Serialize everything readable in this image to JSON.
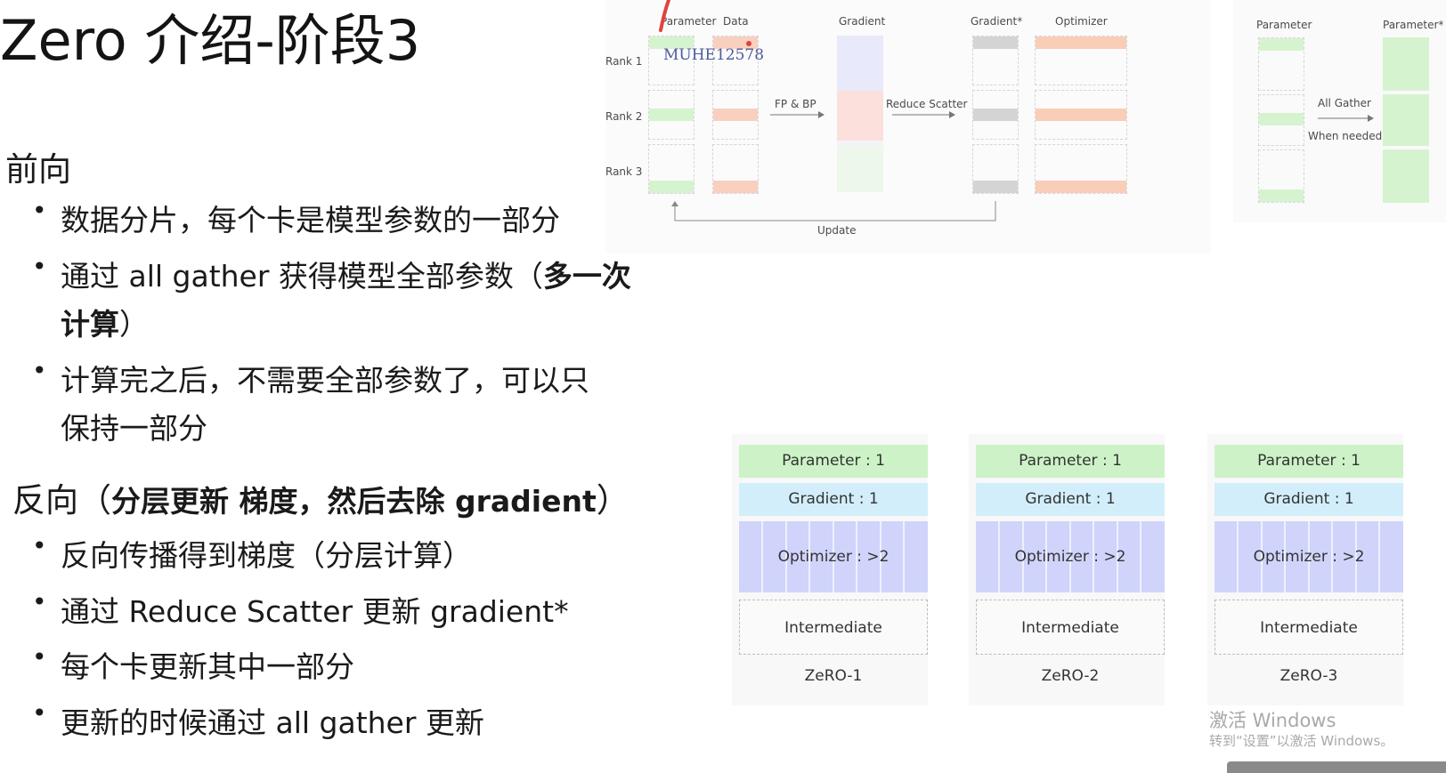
{
  "title": "Zero 介绍-阶段3",
  "forward": {
    "heading": "前向",
    "bullets": [
      {
        "text": "数据分片，每个卡是模型参数的一部分"
      },
      {
        "text": "通过 all gather 获得模型全部参数（",
        "bold": "多一次",
        "line2_bold": "计算",
        "line2_tail": "）"
      },
      {
        "text": "计算完之后，不需要全部参数了，可以只",
        "line2": "保持一部分"
      }
    ]
  },
  "backward": {
    "heading_plain": "反向（",
    "heading_bold": "分层更新 梯度，然后去除 gradient",
    "heading_tail": "）",
    "bullets": [
      "反向传播得到梯度（分层计算）",
      "通过 Reduce Scatter 更新 gradient*",
      "每个卡更新其中一部分",
      "更新的时候通过 all gather 更新"
    ]
  },
  "top_diagram": {
    "col_labels": [
      "Parameter",
      "Data",
      "Gradient",
      "Gradient*",
      "Optimizer"
    ],
    "rank_labels": [
      "Rank 1",
      "Rank 2",
      "Rank 3"
    ],
    "step1": "FP & BP",
    "step2": "Reduce Scatter",
    "update": "Update",
    "overlay_id": "MUHE12578"
  },
  "right_diagram": {
    "left_label": "Parameter",
    "right_label": "Parameter*",
    "all_gather": "All Gather",
    "when_needed": "When needed"
  },
  "zero_panels": [
    {
      "parameter": "Parameter : 1",
      "gradient": "Gradient : 1",
      "optimizer": "Optimizer : >2",
      "intermediate": "Intermediate",
      "name": "ZeRO-1"
    },
    {
      "parameter": "Parameter : 1",
      "gradient": "Gradient : 1",
      "optimizer": "Optimizer : >2",
      "intermediate": "Intermediate",
      "name": "ZeRO-2"
    },
    {
      "parameter": "Parameter : 1",
      "gradient": "Gradient : 1",
      "optimizer": "Optimizer : >2",
      "intermediate": "Intermediate",
      "name": "ZeRO-3"
    }
  ],
  "watermark": {
    "line1": "激活 Windows",
    "line2": "转到“设置”以激活 Windows。"
  },
  "colors": {
    "param_green": "#cdf2c8",
    "gradient_blue": "#d3eefb",
    "optimizer_purple": "#d0d4fb",
    "data_orange": "#f9c9b4"
  }
}
